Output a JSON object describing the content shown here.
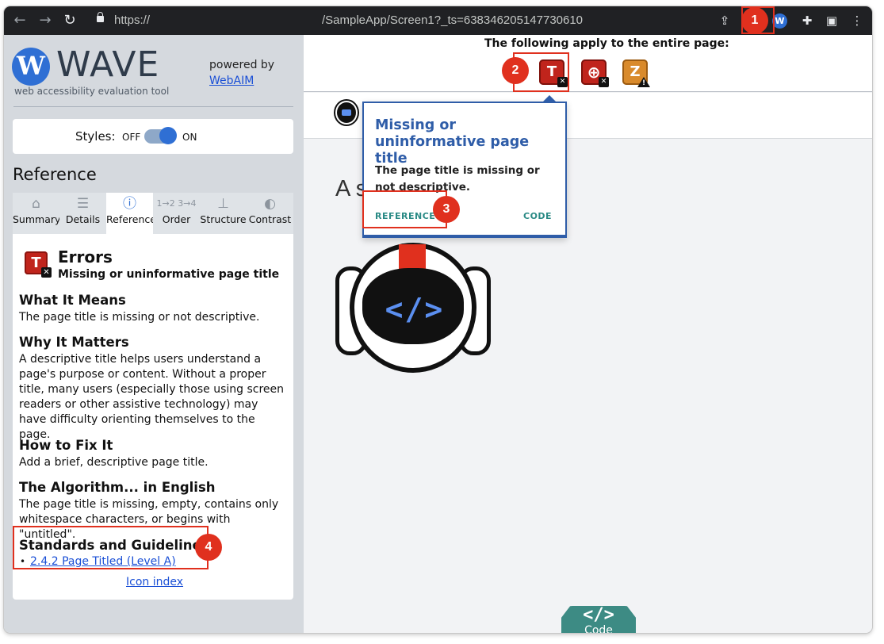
{
  "browser": {
    "url_scheme": "https://",
    "url_path": "/SampleApp/Screen1?_ts=638346205147730610"
  },
  "sidebar": {
    "logo_text": "WAVE",
    "logo_subtitle": "web accessibility evaluation tool",
    "powered_by": "powered by",
    "powered_link": "WebAIM",
    "styles_label": "Styles:",
    "styles_off": "OFF",
    "styles_on": "ON",
    "reference_heading": "Reference",
    "tabs": [
      {
        "label": "Summary",
        "icon": "home-icon"
      },
      {
        "label": "Details",
        "icon": "list-icon"
      },
      {
        "label": "Reference",
        "icon": "info-icon"
      },
      {
        "label": "Order",
        "icon": "order-icon"
      },
      {
        "label": "Structure",
        "icon": "structure-icon"
      },
      {
        "label": "Contrast",
        "icon": "contrast-icon"
      }
    ],
    "active_tab": "Reference",
    "reference": {
      "category": "Errors",
      "item": "Missing or uninformative page title",
      "what_h": "What It Means",
      "what_p": "The page title is missing or not descriptive.",
      "why_h": "Why It Matters",
      "why_p": "A descriptive title helps users understand a page's purpose or content. Without a proper title, many users (especially those using screen readers or other assistive technology) may have difficulty orienting themselves to the page.",
      "fix_h": "How to Fix It",
      "fix_p": "Add a brief, descriptive page title.",
      "algo_h": "The Algorithm... in English",
      "algo_p": "The page title is missing, empty, contains only whitespace characters, or begins with \"untitled\".",
      "std_h": "Standards and Guidelines",
      "std_link": "2.4.2 Page Titled (Level A)",
      "icon_index": "Icon index"
    }
  },
  "main": {
    "apply_text": "The following apply to the entire page:",
    "page_heading_partial": "A s",
    "tooltip": {
      "title": "Missing or uninformative page title",
      "description": "The page title is missing or not descriptive.",
      "reference": "REFERENCE",
      "code": "CODE"
    },
    "code_tab": {
      "icon": "</>",
      "label": "Code"
    }
  },
  "steps": [
    "1",
    "2",
    "3",
    "4"
  ],
  "colors": {
    "error": "#c0241c",
    "alert": "#d98a2b",
    "highlight": "#e0301e",
    "accent": "#2f6fd4",
    "tooltip_border": "#2f5da8"
  }
}
